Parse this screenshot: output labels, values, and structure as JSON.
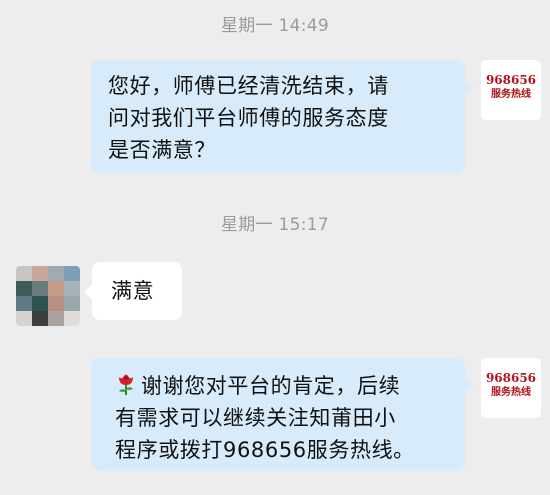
{
  "messages": [
    {
      "timestamp": "星期一  14:49",
      "text": "您好，师傅已经清洗结束，请问对我们平台师傅的服务态度是否满意？",
      "lines": [
        "您好，师傅已经清洗结束，请",
        "问对我们平台师傅的服务态度",
        "是否满意？"
      ],
      "sender": "service"
    },
    {
      "timestamp": "星期一  15:17",
      "text": "满意",
      "lines": [
        "满意"
      ],
      "sender": "user"
    },
    {
      "text": "谢谢您对平台的肯定，后续有需求可以继续关注知莆田小程序或拨打968656服务热线。",
      "lines": [
        "谢谢您对平台的肯定，后续",
        "有需求可以继续关注知莆田小",
        "程序或拨打968656服务热线。"
      ],
      "emoji": "rose-icon",
      "sender": "service"
    }
  ],
  "service_avatar": {
    "number": "968656",
    "label": "服务热线"
  },
  "colors": {
    "background": "#ededed",
    "my_bubble": "#d7ebfa",
    "their_bubble": "#ffffff",
    "timestamp": "#9b9b9b",
    "avatar_text": "#b0141c"
  }
}
